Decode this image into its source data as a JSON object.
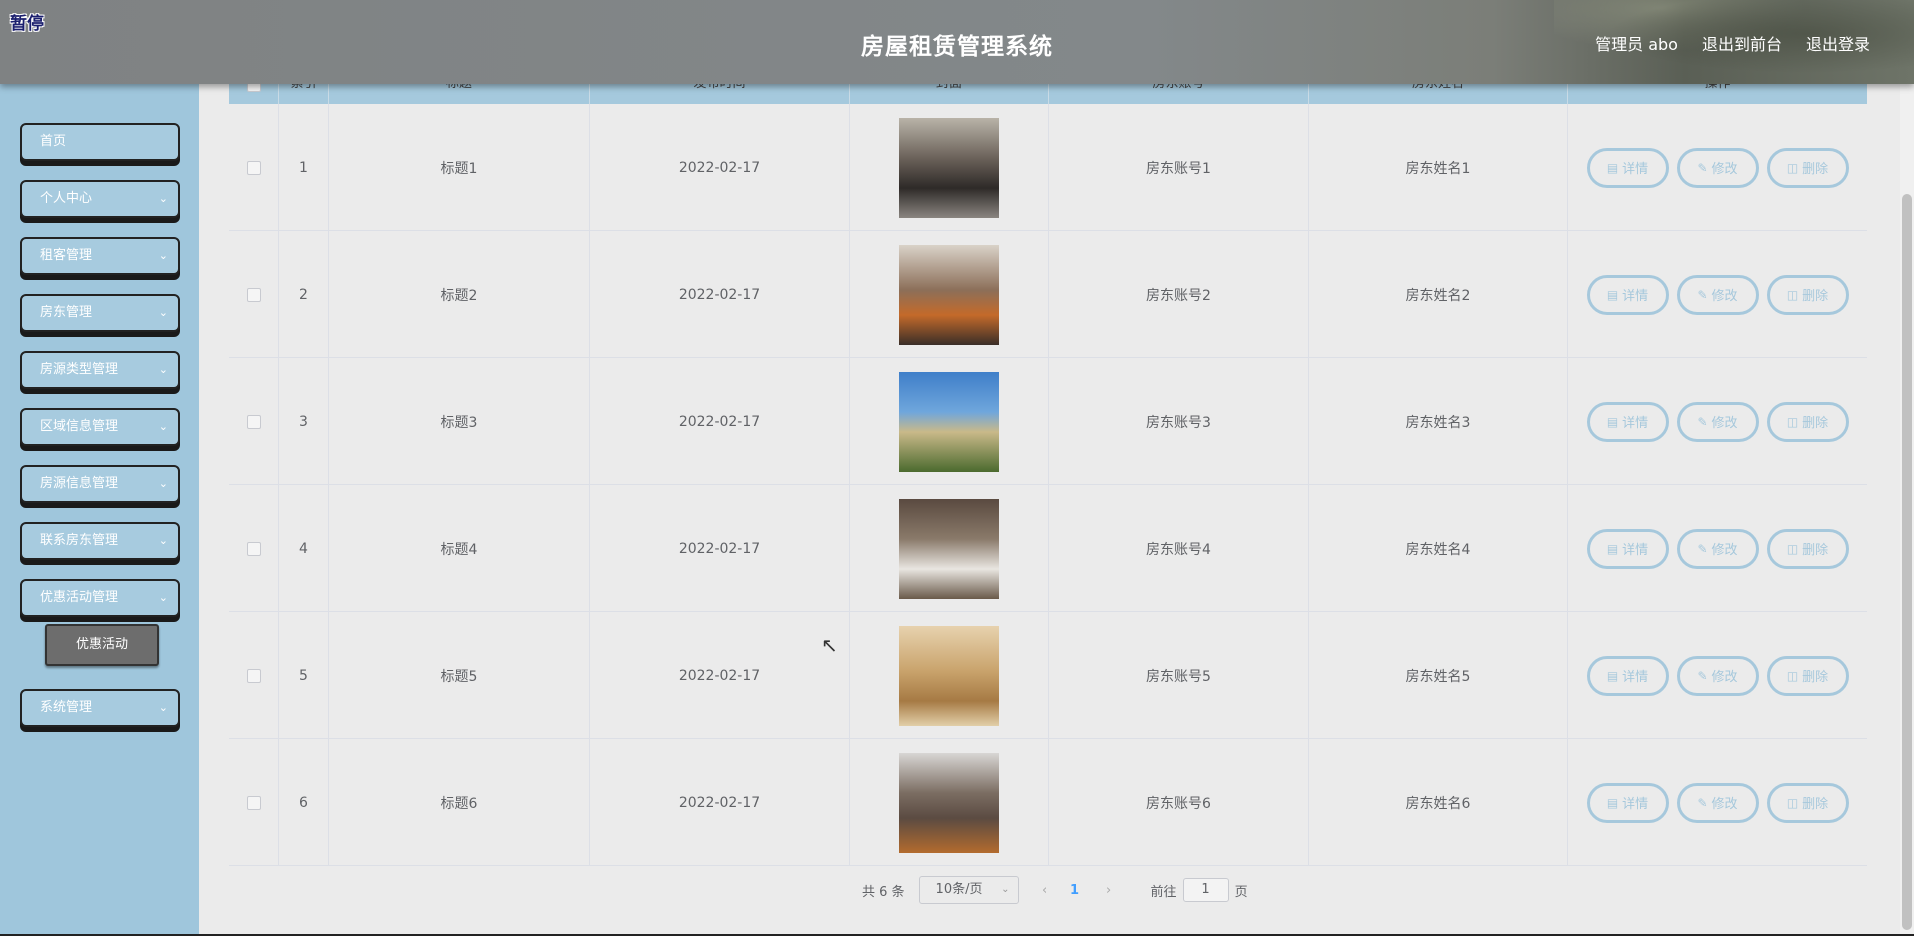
{
  "header": {
    "pause_label": "暂停",
    "title": "房屋租赁管理系统",
    "user": "管理员 abo",
    "to_front": "退出到前台",
    "logout": "退出登录"
  },
  "sidebar": {
    "items": [
      {
        "label": "首页",
        "has_children": false
      },
      {
        "label": "个人中心",
        "has_children": true
      },
      {
        "label": "租客管理",
        "has_children": true
      },
      {
        "label": "房东管理",
        "has_children": true
      },
      {
        "label": "房源类型管理",
        "has_children": true
      },
      {
        "label": "区域信息管理",
        "has_children": true
      },
      {
        "label": "房源信息管理",
        "has_children": true
      },
      {
        "label": "联系房东管理",
        "has_children": true
      },
      {
        "label": "优惠活动管理",
        "has_children": true
      },
      {
        "label": "系统管理",
        "has_children": true
      }
    ],
    "sub_item": "优惠活动"
  },
  "table": {
    "columns": [
      "",
      "索引",
      "标题",
      "发布时间",
      "封面",
      "房东账号",
      "房东姓名",
      "操作"
    ],
    "actions": {
      "detail": "详情",
      "edit": "修改",
      "delete": "删除"
    },
    "rows": [
      {
        "index": "1",
        "title": "标题1",
        "date": "2022-02-17",
        "account": "房东账号1",
        "name": "房东姓名1",
        "image": "living-room-dark"
      },
      {
        "index": "2",
        "title": "标题2",
        "date": "2022-02-17",
        "account": "房东账号2",
        "name": "房东姓名2",
        "image": "living-room-orange"
      },
      {
        "index": "3",
        "title": "标题3",
        "date": "2022-02-17",
        "account": "房东账号3",
        "name": "房东姓名3",
        "image": "villa-exterior"
      },
      {
        "index": "4",
        "title": "标题4",
        "date": "2022-02-17",
        "account": "房东账号4",
        "name": "房东姓名4",
        "image": "bedroom"
      },
      {
        "index": "5",
        "title": "标题5",
        "date": "2022-02-17",
        "account": "房东账号5",
        "name": "房东姓名5",
        "image": "warm-living-room"
      },
      {
        "index": "6",
        "title": "标题6",
        "date": "2022-02-17",
        "account": "房东账号6",
        "name": "房东姓名6",
        "image": "wood-floor-living-room"
      }
    ]
  },
  "pagination": {
    "total": "共 6 条",
    "page_size": "10条/页",
    "current_page": "1",
    "goto_label": "前往",
    "goto_value": "1",
    "page_suffix": "页"
  },
  "colors": {
    "accent": "#a6c8dc",
    "sidebar": "#9fc6dc",
    "page_active": "#409eff"
  }
}
